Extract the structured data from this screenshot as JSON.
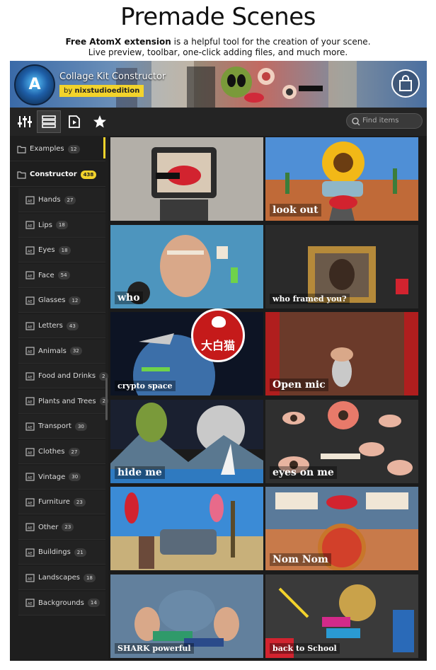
{
  "page": {
    "heading": "Premade Scenes",
    "subtitle_bold": "Free AtomX extension",
    "subtitle_line1_rest": " is a helpful tool for the creation of your scene.",
    "subtitle_line2": "Live preview, toolbar, one-click adding files, and much more."
  },
  "app": {
    "title": "Collage Kit Constructor",
    "author_prefix": "by ",
    "author_name": "nixstudioedition"
  },
  "toolbar": {
    "search_placeholder": "Find items",
    "buttons": [
      "sliders-icon",
      "list-view-icon",
      "preview-icon",
      "star-icon"
    ]
  },
  "sidebar": {
    "top_items": [
      {
        "label": "Examples",
        "count": "12"
      },
      {
        "label": "Constructor",
        "count": "438"
      }
    ],
    "sub_items": [
      {
        "label": "Hands",
        "count": "27"
      },
      {
        "label": "Lips",
        "count": "18"
      },
      {
        "label": "Eyes",
        "count": "18"
      },
      {
        "label": "Face",
        "count": "54"
      },
      {
        "label": "Glasses",
        "count": "12"
      },
      {
        "label": "Letters",
        "count": "43"
      },
      {
        "label": "Animals",
        "count": "32"
      },
      {
        "label": "Food and Drinks",
        "count": "2"
      },
      {
        "label": "Plants and Trees",
        "count": "2"
      },
      {
        "label": "Transport",
        "count": "30"
      },
      {
        "label": "Clothes",
        "count": "27"
      },
      {
        "label": "Vintage",
        "count": "30"
      },
      {
        "label": "Furniture",
        "count": "23"
      },
      {
        "label": "Other",
        "count": "23"
      },
      {
        "label": "Buildings",
        "count": "21"
      },
      {
        "label": "Landscapes",
        "count": "18"
      },
      {
        "label": "Backgrounds",
        "count": "14"
      }
    ]
  },
  "tiles": [
    {
      "scene": "tv-head-collage",
      "label": ""
    },
    {
      "scene": "sunflower-car-road",
      "label": "look out"
    },
    {
      "scene": "letters-face-collage",
      "label": "who"
    },
    {
      "scene": "who-framed-you",
      "label": "who framed you?"
    },
    {
      "scene": "crypto-space",
      "label": "crypto space"
    },
    {
      "scene": "open-mic",
      "label": "Open mic"
    },
    {
      "scene": "hide-me-alien",
      "label": "hide me"
    },
    {
      "scene": "eyes-on-me",
      "label": "eyes on me"
    },
    {
      "scene": "parrots-sofa",
      "label": ""
    },
    {
      "scene": "nom-nom-pizza",
      "label": "Nom Nom"
    },
    {
      "scene": "shark-powerful",
      "label": "SHARK powerful"
    },
    {
      "scene": "back-to-school",
      "label": "back to School"
    }
  ],
  "watermark": {
    "text": "大白猫"
  },
  "colors": {
    "accent": "#f2d32c",
    "panel_bg": "#1b1b1b",
    "toolbar_bg": "#242424",
    "watermark_red": "#c51a1a"
  }
}
